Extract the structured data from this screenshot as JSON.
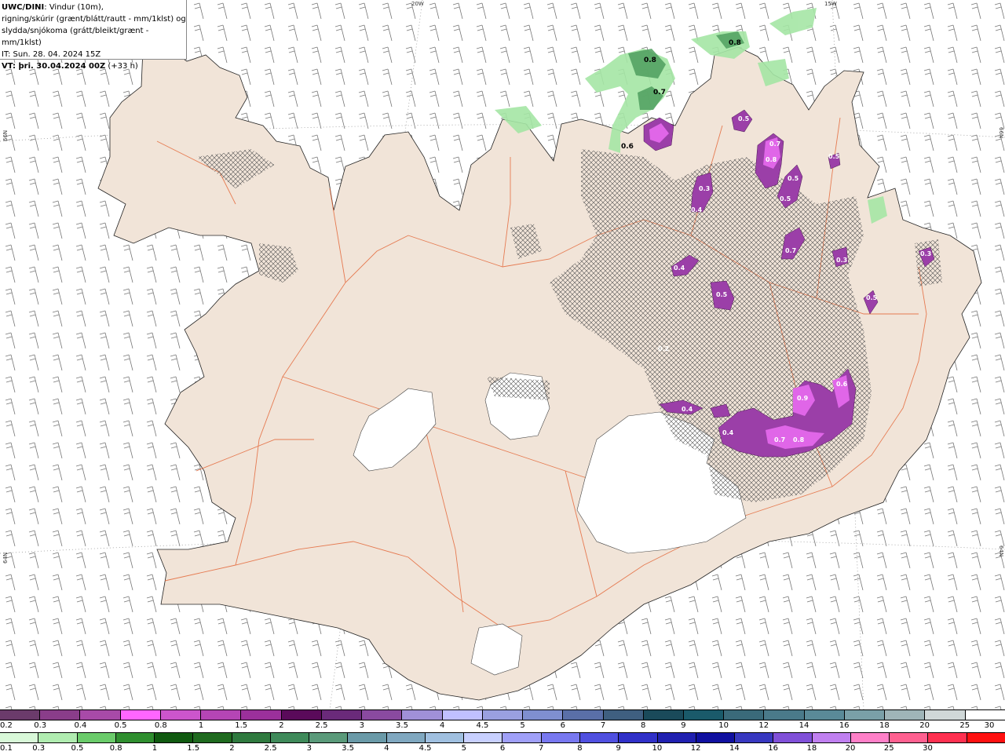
{
  "header": {
    "title_bold": "UWC/DINI",
    "title_rest": ": Vindur (10m),",
    "line2": "rigning/skúrir (grænt/blátt/rautt - mm/1klst) og",
    "line3": "slydda/snjókoma (grátt/bleikt/grænt - mm/1klst)",
    "it_line": "IT: Sun. 28. 04. 2024 15Z",
    "vt_bold": "VT: þri. 30.04.2024 00Z",
    "vt_rest": " (+33 h)"
  },
  "graticule": {
    "lon_labels": [
      "20W",
      "15W"
    ],
    "lat_labels": [
      "66N",
      "64N"
    ]
  },
  "map_labels": {
    "green": [
      "0.8",
      "0.8",
      "0.7",
      "0.6"
    ],
    "purple": [
      "0.5",
      "0.7",
      "0.8",
      "0.5",
      "0.5",
      "0.3",
      "0.4",
      "0.5",
      "0.7",
      "0.3",
      "0.4",
      "0.5",
      "0.5",
      "0.3",
      "0.2",
      "0.6",
      "0.9",
      "0.4",
      "0.4",
      "0.7",
      "0.8"
    ]
  },
  "legend": {
    "snow_colors": [
      "#6b3b6b",
      "#8a3d8a",
      "#a84aa8",
      "#ff66ff",
      "#cc55cc",
      "#b545b5",
      "#9b309b",
      "#5a0a5a",
      "#6a2a7a",
      "#8a4aa0",
      "#a090d8",
      "#c0c0ff",
      "#9aa0e0",
      "#7f8fd0",
      "#5a6fa8",
      "#3f5f80",
      "#1a4a5a",
      "#1a5a6a",
      "#3a6a7a",
      "#4a7a8a",
      "#5a8a98",
      "#7aa0a8",
      "#9fb5b8",
      "#d0d8d8",
      "#ffffff"
    ],
    "snow_labels": [
      "0.2",
      "0.3",
      "0.4",
      "0.5",
      "0.8",
      "1",
      "1.5",
      "2",
      "2.5",
      "3",
      "3.5",
      "4",
      "4.5",
      "5",
      "6",
      "7",
      "8",
      "9",
      "10",
      "12",
      "14",
      "16",
      "18",
      "20",
      "25",
      "30"
    ],
    "rain_colors": [
      "#d8f8d8",
      "#b0ecb0",
      "#6acb6a",
      "#2f8f2f",
      "#105a10",
      "#1f6a1f",
      "#2f7a3f",
      "#3f8a5a",
      "#5a9a7a",
      "#6a9aa8",
      "#80a8c0",
      "#a0c0e0",
      "#c8d0ff",
      "#a0a0f8",
      "#7878f0",
      "#5050e0",
      "#3030c8",
      "#2020b0",
      "#1010a0",
      "#3838c0",
      "#8050d8",
      "#c080f0",
      "#ff80c8",
      "#ff6090",
      "#ff3050",
      "#ff1010"
    ],
    "rain_labels": [
      "0.1",
      "0.3",
      "0.5",
      "0.8",
      "1",
      "1.5",
      "2",
      "2.5",
      "3",
      "3.5",
      "4",
      "4.5",
      "5",
      "6",
      "7",
      "8",
      "9",
      "10",
      "12",
      "14",
      "16",
      "18",
      "20",
      "25",
      "30"
    ]
  },
  "colors": {
    "land": "#f1e4d8",
    "roads": "#e4683a",
    "snow_purple": "#9b3fa8",
    "snow_pink": "#e066e8",
    "rain_green": "#a5e6a5",
    "glacier": "#ffffff"
  }
}
